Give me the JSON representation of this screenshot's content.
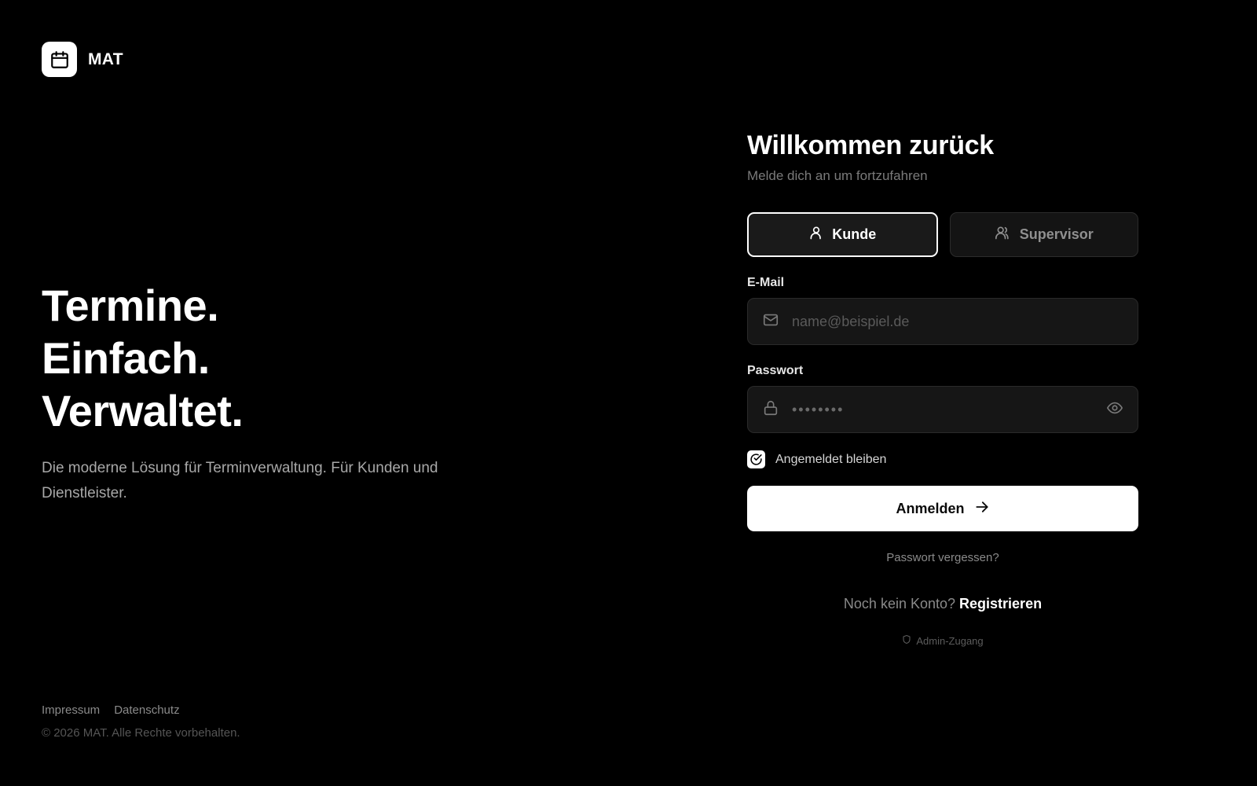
{
  "brand": {
    "name": "MAT",
    "logo_icon": "calendar-icon"
  },
  "hero": {
    "lines": [
      "Termine.",
      "Einfach.",
      "Verwaltet."
    ],
    "subtitle": "Die moderne Lösung für Terminverwaltung. Für Kunden und Dienstleister."
  },
  "footer": {
    "links": [
      "Impressum",
      "Datenschutz"
    ],
    "copyright": "© 2026 MAT. Alle Rechte vorbehalten."
  },
  "form": {
    "title": "Willkommen zurück",
    "subtitle": "Melde dich an um fortzufahren",
    "roles": [
      {
        "label": "Kunde",
        "icon": "user-icon",
        "active": true
      },
      {
        "label": "Supervisor",
        "icon": "users-icon",
        "active": false
      }
    ],
    "email": {
      "label": "E-Mail",
      "placeholder": "name@beispiel.de",
      "icon": "mail-icon"
    },
    "password": {
      "label": "Passwort",
      "value_masked": "••••••••",
      "icon": "lock-icon",
      "toggle_icon": "eye-icon"
    },
    "remember": {
      "label": "Angemeldet bleiben",
      "checked": true
    },
    "submit_label": "Anmelden",
    "forgot_label": "Passwort vergessen?",
    "register_prompt": "Noch kein Konto?",
    "register_link": "Registrieren",
    "admin_label": "Admin-Zugang"
  },
  "colors": {
    "background": "#000000",
    "text_primary": "#ffffff",
    "text_muted": "#8a8a8a",
    "input_bg": "#161616",
    "button_primary_bg": "#ffffff"
  }
}
